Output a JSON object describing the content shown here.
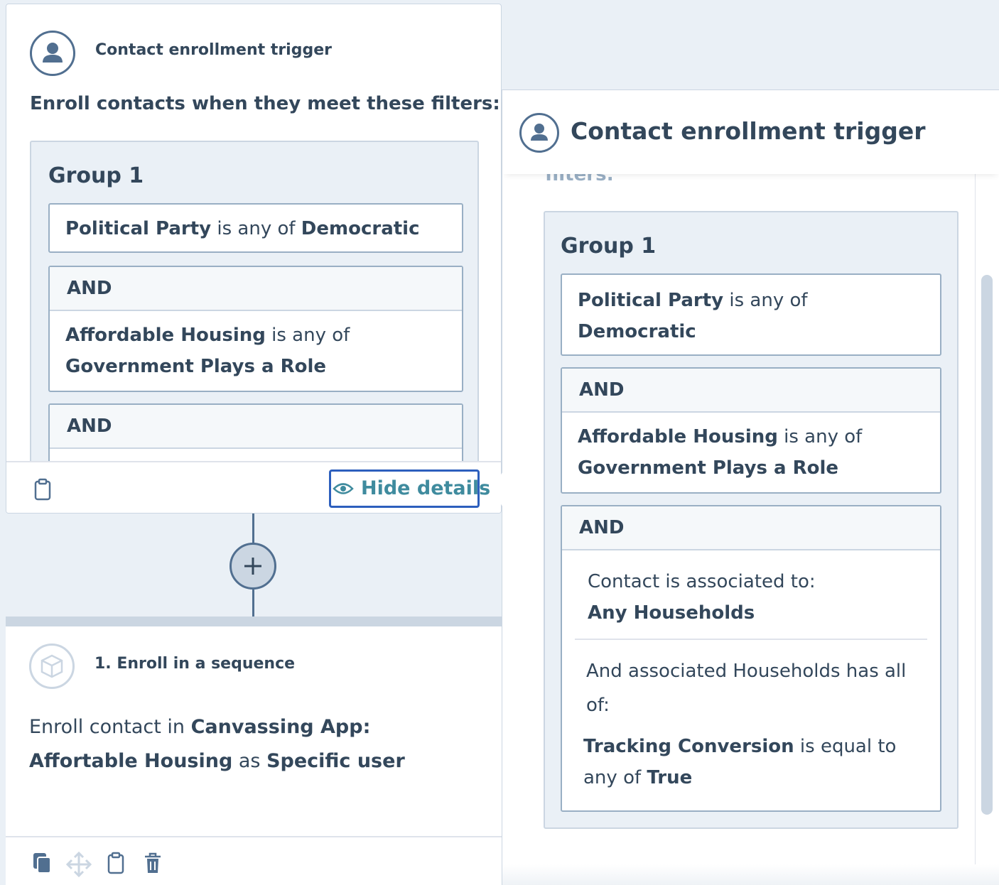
{
  "trigger": {
    "title": "Contact enrollment trigger",
    "enroll_text": "Enroll contacts when they meet these filters:",
    "group_title": "Group 1",
    "and_label": "AND",
    "filter1": {
      "property": "Political Party",
      "op": " is any of ",
      "value": "Democratic"
    },
    "filter2": {
      "property": "Affordable Housing",
      "op": " is any of",
      "value": "Government Plays a Role"
    },
    "hide_details": "Hide details"
  },
  "action": {
    "title": "1. Enroll in a sequence",
    "text_1": "Enroll contact in ",
    "sequence_name": "Canvassing App: Affortable Housing",
    "text_2": " as ",
    "user_type": "Specific user"
  },
  "panel": {
    "title": "Contact enrollment trigger",
    "cut_text": "filters:",
    "group_title": "Group 1",
    "and_label": "AND",
    "filter1": {
      "property": "Political Party",
      "op": " is any of",
      "value": "Democratic"
    },
    "filter2": {
      "property": "Affordable Housing",
      "op": " is any of",
      "value": "Government Plays a Role"
    },
    "filter3": {
      "assoc_text": "Contact is associated to:",
      "assoc_value": "Any Households",
      "assoc_all": "And associated Households has all of:",
      "property": "Tracking Conversion",
      "op": " is equal to any of ",
      "value": "True"
    }
  },
  "icons": {
    "avatar": "contact-avatar-icon",
    "sequence": "cube-icon",
    "clipboard": "clipboard-icon",
    "eye": "eye-icon",
    "plus": "plus-icon",
    "copy": "copy-icon",
    "move": "move-icon",
    "trash": "trash-icon"
  },
  "colors": {
    "text": "#33475b",
    "border": "#cbd6e2",
    "accent": "#3f8b9e",
    "focus": "#2d5fbd",
    "background": "#eaf0f6"
  }
}
